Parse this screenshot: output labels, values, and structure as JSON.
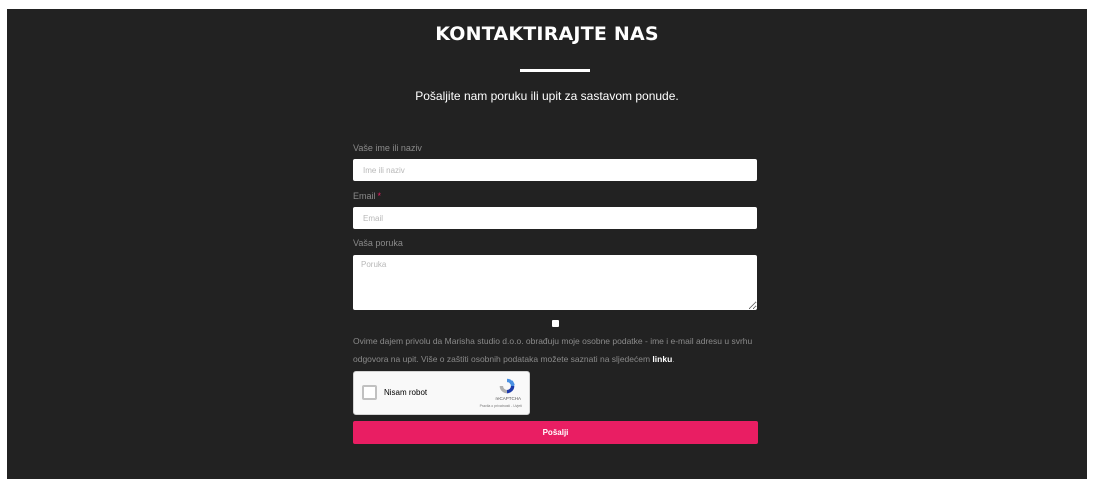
{
  "header": {
    "title": "KONTAKTIRAJTE NAS",
    "subtitle": "Pošaljite nam poruku ili upit za sastavom ponude."
  },
  "form": {
    "name": {
      "label": "Vaše ime ili naziv",
      "placeholder": "Ime ili naziv",
      "value": ""
    },
    "email": {
      "label": "Email",
      "required_mark": "*",
      "placeholder": "Email",
      "value": ""
    },
    "message": {
      "label": "Vaša poruka",
      "placeholder": "Poruka",
      "value": ""
    },
    "consent": {
      "text": "Ovime dajem privolu da Marisha studio d.o.o. obrađuju moje osobne podatke - ime i e-mail adresu u svrhu odgovora na upit. Više o zaštiti osobnih podataka možete saznati na sljedećem ",
      "link_text": "linku",
      "suffix": ".",
      "checked": false
    },
    "recaptcha": {
      "label": "Nisam robot",
      "brand": "reCAPTCHA",
      "terms": "Pravila o privatnosti - Uvjeti"
    },
    "submit_label": "Pošalji"
  },
  "colors": {
    "background": "#222222",
    "accent": "#e91e63",
    "text_light": "#ffffff",
    "text_muted": "#8a8a8a"
  }
}
